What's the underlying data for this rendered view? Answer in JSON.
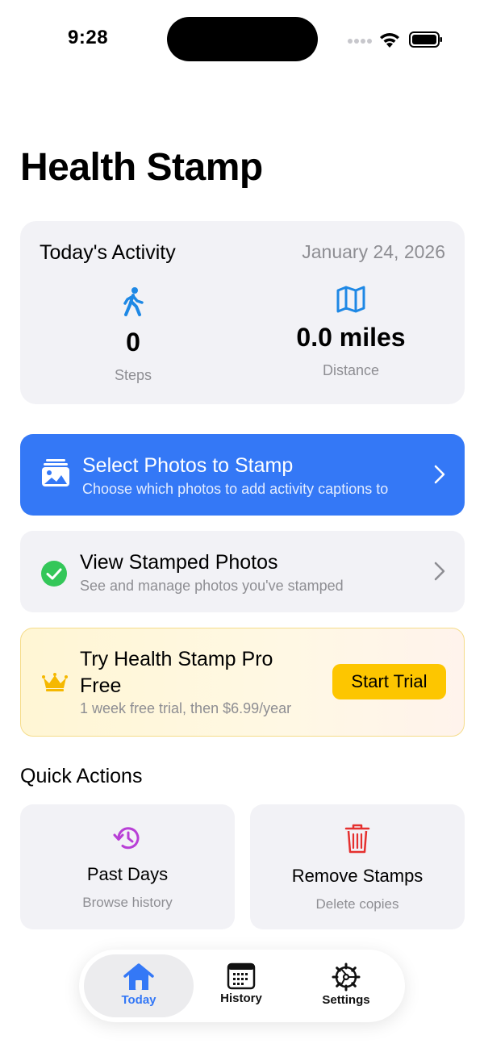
{
  "status_bar": {
    "time": "9:28"
  },
  "page_title": "Health Stamp",
  "activity": {
    "title": "Today's Activity",
    "date": "January 24, 2026",
    "steps_value": "0",
    "steps_label": "Steps",
    "steps_icon": "walking-figure-icon",
    "distance_value": "0.0 miles",
    "distance_label": "Distance",
    "distance_icon": "map-icon"
  },
  "select_photos": {
    "title": "Select Photos to Stamp",
    "subtitle": "Choose which photos to add activity captions to",
    "icon": "photo-stack-icon"
  },
  "view_stamped": {
    "title": "View Stamped Photos",
    "subtitle": "See and manage photos you've stamped",
    "icon": "checkmark-circle-icon"
  },
  "trial": {
    "title": "Try Health Stamp Pro Free",
    "subtitle": "1 week free trial, then $6.99/year",
    "button": "Start Trial",
    "icon": "crown-icon"
  },
  "quick_actions": {
    "title": "Quick Actions",
    "items": [
      {
        "title": "Past Days",
        "subtitle": "Browse history",
        "icon": "history-clock-icon"
      },
      {
        "title": "Remove Stamps",
        "subtitle": "Delete copies",
        "icon": "trash-icon"
      }
    ]
  },
  "tabs": [
    {
      "label": "Today",
      "icon": "house-icon",
      "selected": true
    },
    {
      "label": "History",
      "icon": "calendar-icon",
      "selected": false
    },
    {
      "label": "Settings",
      "icon": "gear-icon",
      "selected": false
    }
  ],
  "colors": {
    "accent": "#3478f6",
    "success": "#34c759",
    "trial_button": "#fdc600",
    "history_icon": "#b83fd6",
    "trash_icon": "#e5302f",
    "card_bg": "#f2f2f6",
    "secondary_text": "#8e8e93"
  }
}
